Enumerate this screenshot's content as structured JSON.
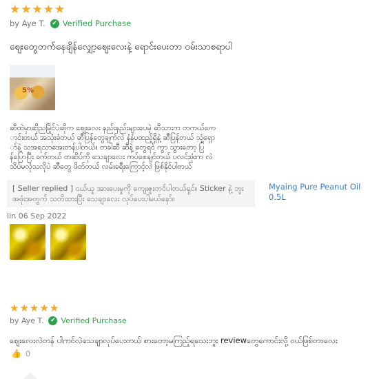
{
  "review1": {
    "stars": 5,
    "author": "by Aye T.",
    "verified_label": "Verified Purchase",
    "headline": "ဈေးတွေတက်နေချိန်လျှော့ဈေးလေးနဲ့ ရောင်းပေးတာ ဝမ်းသာစရာပါ",
    "photo_icon": "product-photo",
    "body_lines": [
      "ဆီထဲမှာဆိုညမြိုင်ပဲဆိုက ဈေးလေး နည်းနည်းများပေမဲ့ ဆီသားက တကယ်ကေ",
      "ာင်းတယ် အသုံးခံတယ် ဆီပြန်တွေချက်လဲ နံနံပထည့်ရှိနဲ့ ဆီပြန်တယ် သုံ့ရှော",
      "ာ်နဲ့ သအရသာအေးတန်ပါတယ်။ တခါဆီ ဆီနဲ့ တွေရင် ကွာ သွားတော့ ပြ",
      "န်ပြောပြီး ခက်တယ် တဆိပ်ကို သေချာလေး ကပ်စေချင်တယ် ပလင်းဖုံးက လဲ",
      "သိပ်မလုံသလိုပဲ ဆီတွေ ဖိတ်တယ် လမ်းခရီးကြောင့်လဲ ဖြစ်နိုင်ပါတယ်"
    ],
    "seller_reply": "[ Seller replied ] ဝယ်ယူ အားပေးမှုကို ကျေးဇူးတင်ပါတယ်ရှင်။ Sticker နဲ့ ဘူးအဖုံးအတွက် သတိထားပြီး သေချာလေး လုပ်ပေးပါမယ်နော်။",
    "product_link": "Myaing Pure Peanut Oil 0.5L",
    "date": "Iin 06 Sep 2022",
    "thumbnails": [
      "peanut-oil-photo",
      "peanut-oil-photo"
    ]
  },
  "review2": {
    "stars": 5,
    "author": "by Aye T.",
    "verified_label": "Verified Purchase",
    "headline": "ဈေးလေးလဲတန် ပါကင်လဲသေချာလုပ်ပေးတယ် စားတော့မကြည့်ရသေးဘူး reviewတွေကောင်းလို့ ဝယ်ဖြစ်တာလေး",
    "like_count": "0"
  },
  "colors": {
    "star": "#f5a623",
    "verified": "#2fa24f",
    "link": "#3a7fcf"
  }
}
